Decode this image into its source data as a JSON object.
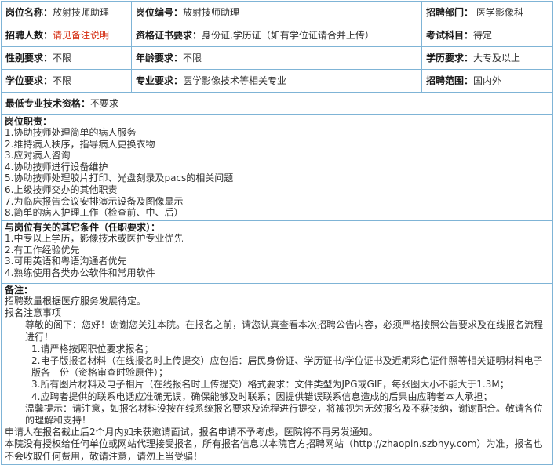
{
  "row1": {
    "name_label": "岗位名称：",
    "name_value": "放射技师助理",
    "code_label": "岗位编号：",
    "code_value": "放射技师助理",
    "dept_label": "招聘部门：",
    "dept_value": "医学影像科"
  },
  "row2": {
    "count_label": "招聘人数：",
    "count_value": "请见备注说明",
    "cert_label": "资格证书要求：",
    "cert_value": "身份证,学历证（如有学位证请合并上传）",
    "exam_label": "考试科目：",
    "exam_value": "待定"
  },
  "row3": {
    "gender_label": "性别要求：",
    "gender_value": "不限",
    "age_label": "年龄要求：",
    "age_value": "不限",
    "edu_label": "学历要求：",
    "edu_value": "大专及以上"
  },
  "row4": {
    "degree_label": "学位要求：",
    "degree_value": "不限",
    "major_label": "专业要求：",
    "major_value": "医学影像技术等相关专业",
    "scope_label": "招聘范围：",
    "scope_value": "国内外"
  },
  "row5": {
    "qual_label": "最低专业技术资格：",
    "qual_value": "不要求"
  },
  "duties": {
    "title": "岗位职责：",
    "items": [
      "1.协助技师处理简单的病人服务",
      "2.维持病人秩序，指导病人更换衣物",
      "3.应对病人咨询",
      "4.协助技师进行设备维护",
      "5.协助技师处理胶片打印、光盘刻录及pacs的相关问题",
      "6.上级技师交办的其他职责",
      "7.为临床报告会议安排演示设备及图像显示",
      "8.简单的病人护理工作（检查前、中、后）"
    ]
  },
  "conditions": {
    "title": "与岗位有关的其它条件（任职要求）：",
    "items": [
      "1.中专以上学历，影像技术或医护专业优先",
      "2.有工作经验优先",
      "3.可用英语和粤语沟通者优先",
      "4.熟练使用各类办公软件和常用软件"
    ]
  },
  "notes": {
    "title": "备注：",
    "line1": "招聘数量根据医疗服务发展待定。",
    "line2": "报名注意事项",
    "para1": "尊敬的阁下：您好！谢谢您关注本院。在报名之前，请您认真查看本次招聘公告内容，必须严格按照公告要求及在线报名流程进行！",
    "item1": "1.请严格按照职位要求报名；",
    "item2": "2.电子版报名材料（在线报名时上传提交）应包括：居民身份证、学历证书/学位证书及近期彩色证件照等相关证明材料电子版各一份（资格审查时验原件）；",
    "item3": "3.所有图片材料及电子相片（在线报名时上传提交）格式要求：文件类型为JPG或GIF，每张图大小不能大于1.3M；",
    "item4": "4.应聘者提供的联系电话应准确无误，确保能够及时联系；因提供错误联系信息造成的后果由应聘者本人承担；",
    "tip": "温馨提示：请注意，如报名材料没按在线系统报名要求及流程进行提交，将被视为无效报名及不获接纳，谢谢配合。敬请各位的理解和支持！",
    "line3": "申请人在报名截止后2个月内如未获邀请面试，报名申请不予考虑，医院将不再另发通知。",
    "line4": "本院没有授权给任何单位或网站代理接受报名，所有报名信息以本院官方招聘网站（http://zhaopin.szbhyy.com）为准，报名也不会收取任何费用，敬请注意，请勿上当受骗！"
  }
}
